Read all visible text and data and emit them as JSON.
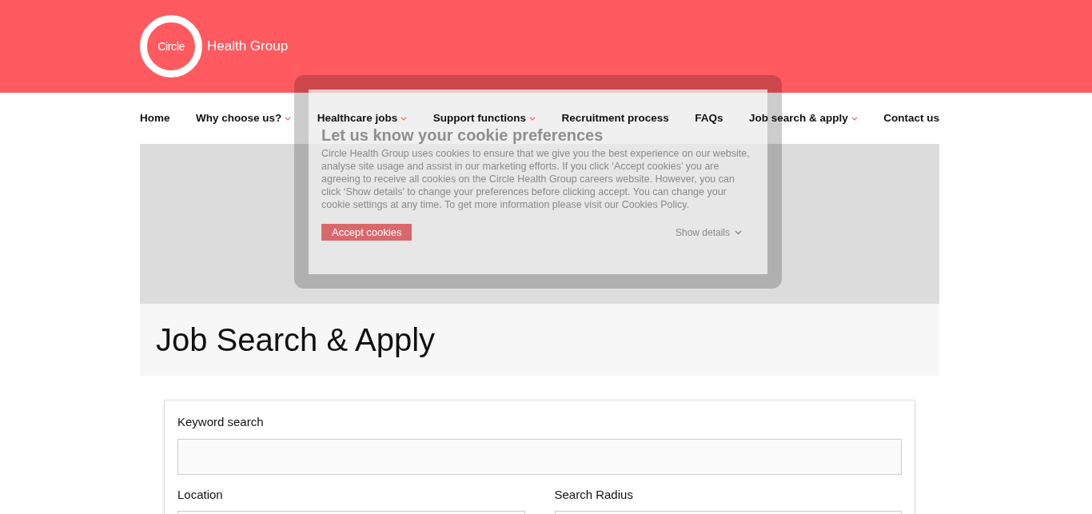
{
  "header": {
    "logo_mark": "Circle",
    "logo_text": "Health Group"
  },
  "nav": [
    {
      "label": "Home",
      "has_menu": false
    },
    {
      "label": "Why choose us?",
      "has_menu": true
    },
    {
      "label": "Healthcare jobs",
      "has_menu": true
    },
    {
      "label": "Support functions",
      "has_menu": true
    },
    {
      "label": "Recruitment process",
      "has_menu": false
    },
    {
      "label": "FAQs",
      "has_menu": false
    },
    {
      "label": "Job search & apply",
      "has_menu": true
    },
    {
      "label": "Contact us",
      "has_menu": false
    }
  ],
  "cookie_dialog": {
    "title": "Let us know your cookie preferences",
    "body": "Circle Health Group uses cookies to ensure that we give you the best experience on our website, analyse site usage and assist in our marketing efforts. If you click ‘Accept cookies’ you are agreeing to receive all cookies on the Circle Health Group careers website. However, you can click ‘Show details’ to change your preferences before clicking accept. You can change your cookie settings at any time. To get more information please visit our Cookies Policy.",
    "accept_button": "Accept cookies",
    "details_link": "Show details"
  },
  "page_title": "Job Search & Apply",
  "search_form": {
    "keyword_label": "Keyword search",
    "location_label": "Location",
    "radius_label": "Search Radius"
  }
}
